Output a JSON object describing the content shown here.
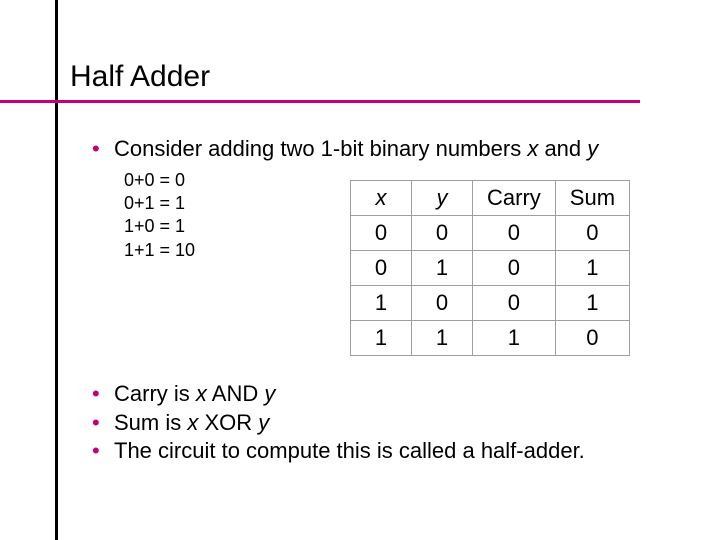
{
  "title": "Half Adder",
  "bullet1_pre": "Consider adding two 1-bit binary numbers ",
  "bullet1_x": "x",
  "bullet1_mid": " and ",
  "bullet1_y": "y",
  "eq": [
    "0+0 = 0",
    "0+1 = 1",
    "1+0 = 1",
    "1+1 = 10"
  ],
  "b2_pre": "Carry is ",
  "b2_x": "x",
  "b2_mid": " AND ",
  "b2_y": "y",
  "b3_pre": "Sum is ",
  "b3_x": "x",
  "b3_mid": " XOR ",
  "b3_y": "y",
  "b4": "The circuit to compute this is called a half-adder.",
  "table": {
    "headers": {
      "x": "x",
      "y": "y",
      "carry": "Carry",
      "sum": "Sum"
    },
    "rows": [
      {
        "x": "0",
        "y": "0",
        "carry": "0",
        "sum": "0"
      },
      {
        "x": "0",
        "y": "1",
        "carry": "0",
        "sum": "1"
      },
      {
        "x": "1",
        "y": "0",
        "carry": "0",
        "sum": "1"
      },
      {
        "x": "1",
        "y": "1",
        "carry": "1",
        "sum": "0"
      }
    ]
  }
}
